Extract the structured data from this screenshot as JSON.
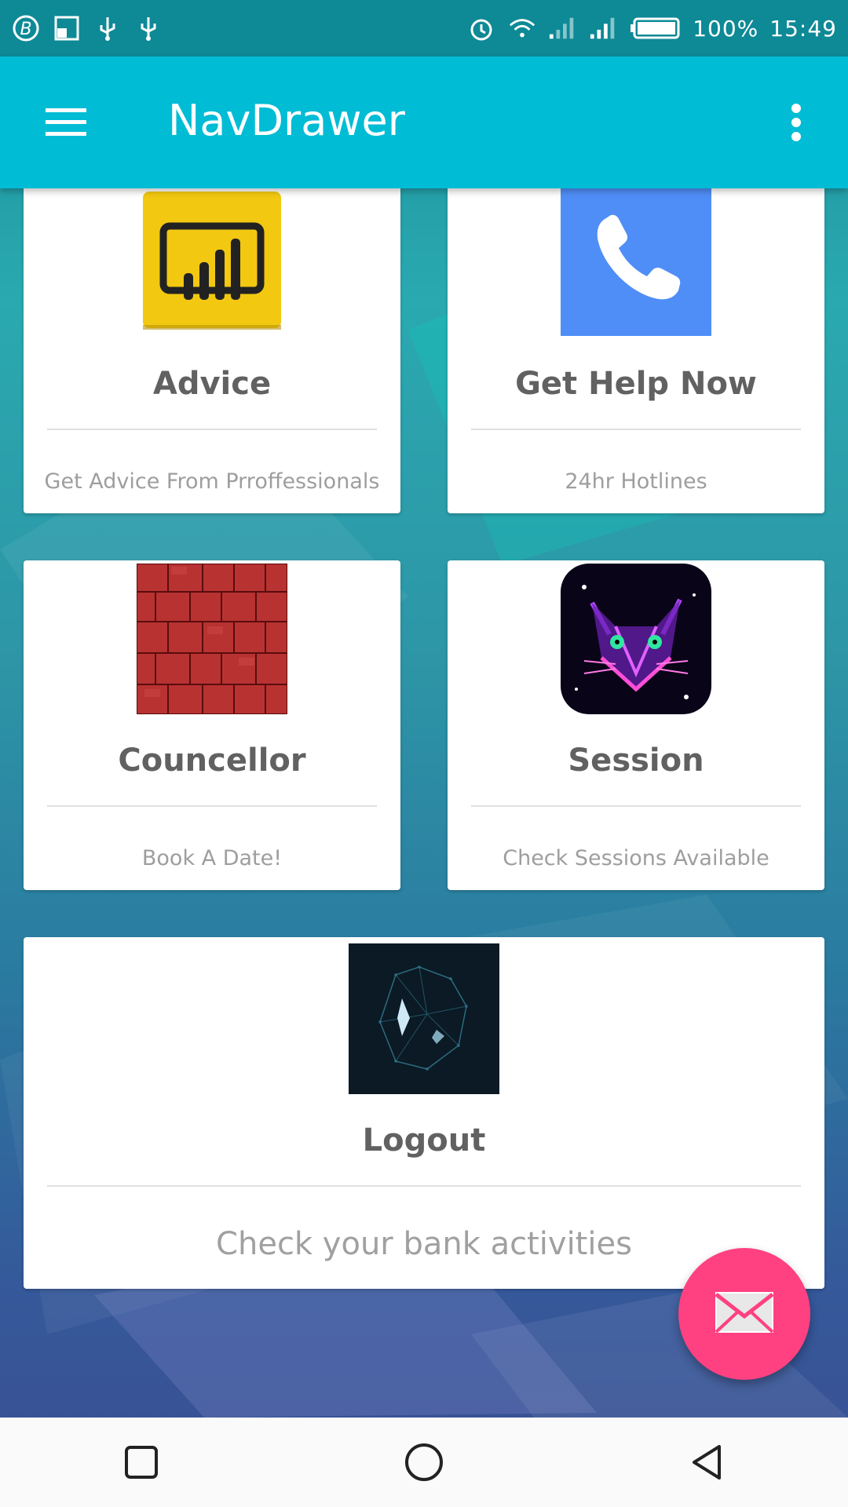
{
  "status_bar": {
    "battery": "100%",
    "time": "15:49",
    "icons": [
      "bluetooth-b-icon",
      "screen-icon",
      "usb-icon",
      "usb-icon",
      "alarm-icon",
      "wifi-icon",
      "signal-icon",
      "signal-icon",
      "battery-icon"
    ]
  },
  "app_bar": {
    "title": "NavDrawer",
    "menu_icon": "hamburger-menu-icon",
    "more_icon": "more-vert-icon",
    "color": "#00bcd4"
  },
  "cards": [
    {
      "title": "Advice",
      "subtitle": "Get Advice From Prroffessionals",
      "icon": "power-bi-chart-icon"
    },
    {
      "title": "Get Help Now",
      "subtitle": "24hr Hotlines",
      "icon": "phone-icon"
    },
    {
      "title": "Councellor",
      "subtitle": "Book A Date!",
      "icon": "red-bricks-image"
    },
    {
      "title": "Session",
      "subtitle": "Check Sessions Available",
      "icon": "neon-cat-image"
    },
    {
      "title": "Logout",
      "subtitle": "Check your bank activities",
      "icon": "digital-face-image"
    }
  ],
  "fab": {
    "icon": "mail-icon",
    "color": "#ff4081"
  },
  "nav_bar": {
    "buttons": [
      "recent-apps-icon",
      "home-icon",
      "back-icon"
    ]
  }
}
